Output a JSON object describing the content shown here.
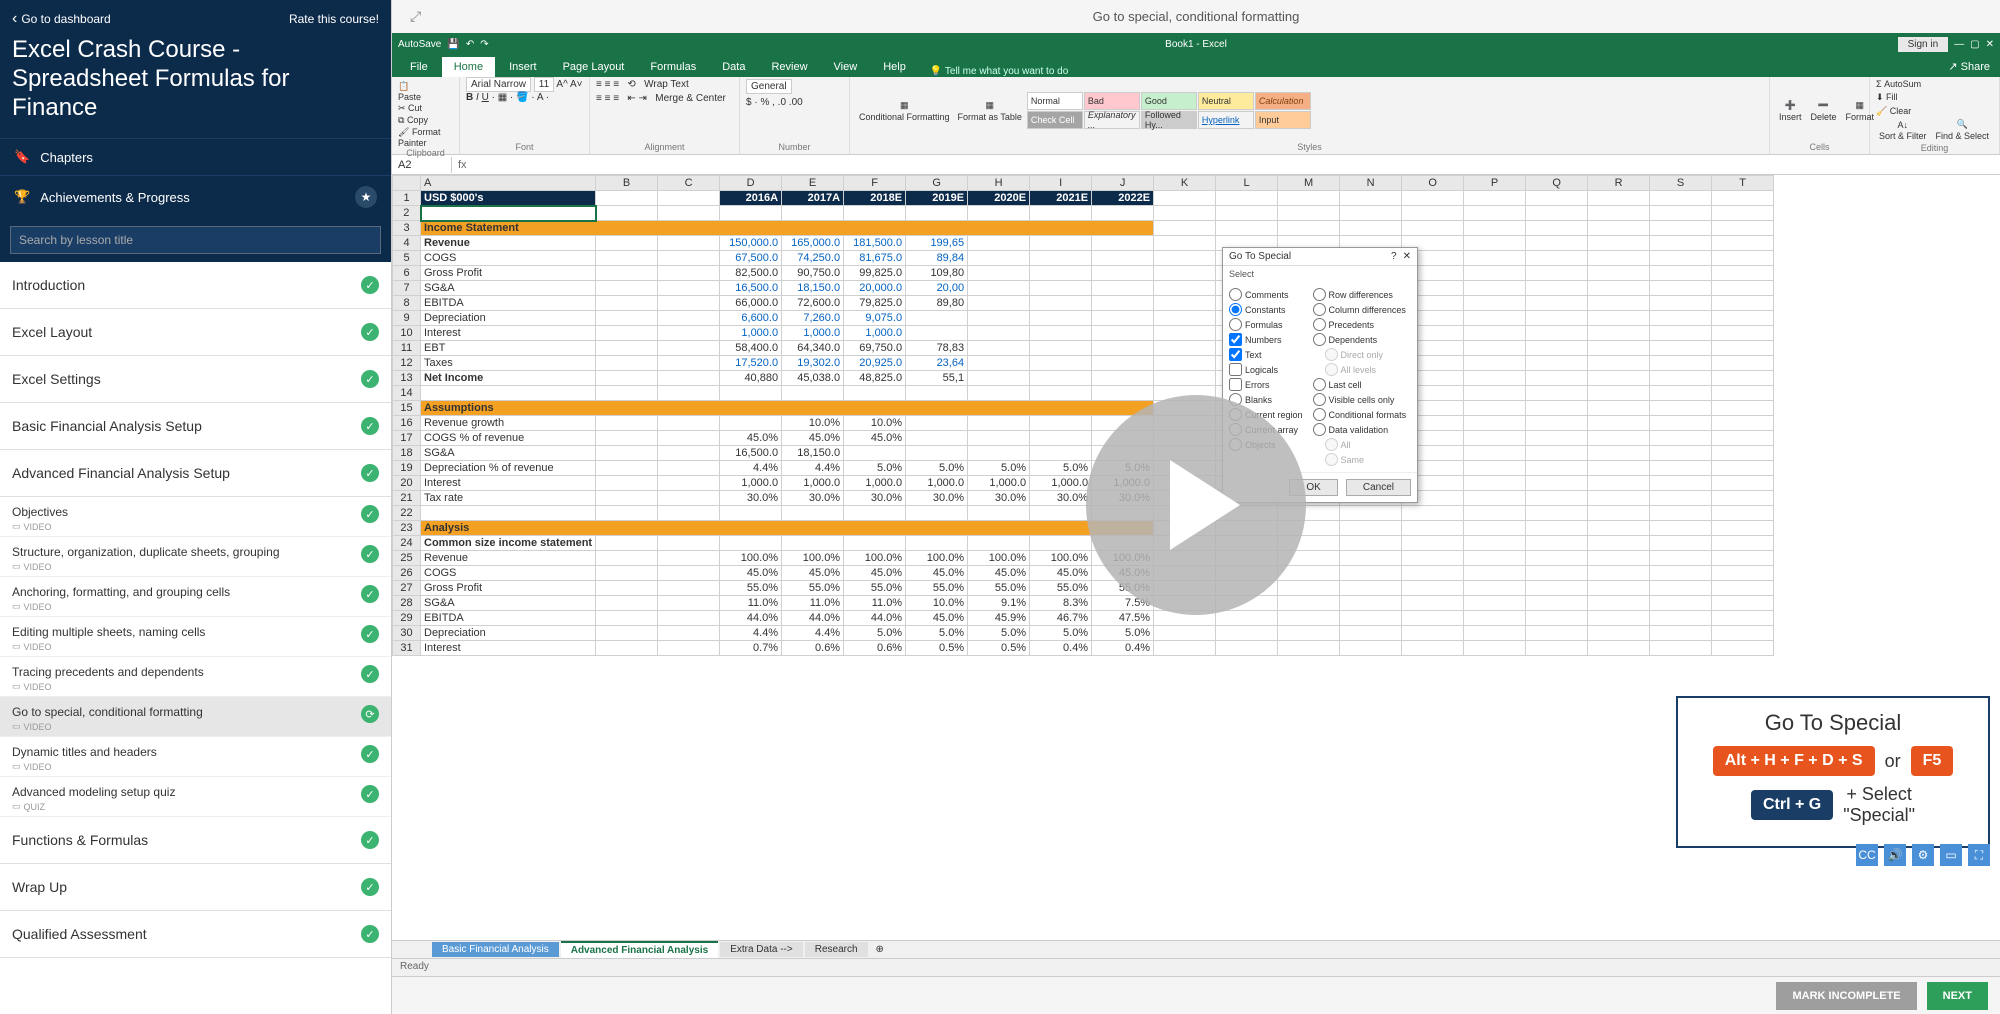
{
  "sidebar": {
    "back": "Go to dashboard",
    "rate": "Rate this course!",
    "course_title": "Excel Crash Course - Spreadsheet Formulas for Finance",
    "chapters_label": "Chapters",
    "achievements_label": "Achievements & Progress",
    "search_placeholder": "Search by lesson title",
    "chapters": [
      {
        "label": "Introduction",
        "done": true
      },
      {
        "label": "Excel Layout",
        "done": true
      },
      {
        "label": "Excel Settings",
        "done": true
      },
      {
        "label": "Basic Financial Analysis Setup",
        "done": true
      },
      {
        "label": "Advanced Financial Analysis Setup",
        "done": true,
        "expanded": true,
        "lessons": [
          {
            "label": "Objectives",
            "type": "VIDEO",
            "done": true
          },
          {
            "label": "Structure, organization, duplicate sheets, grouping",
            "type": "VIDEO",
            "done": true
          },
          {
            "label": "Anchoring, formatting, and grouping cells",
            "type": "VIDEO",
            "done": true
          },
          {
            "label": "Editing multiple sheets, naming cells",
            "type": "VIDEO",
            "done": true
          },
          {
            "label": "Tracing precedents and dependents",
            "type": "VIDEO",
            "done": true
          },
          {
            "label": "Go to special, conditional formatting",
            "type": "VIDEO",
            "done": true,
            "active": true
          },
          {
            "label": "Dynamic titles and headers",
            "type": "VIDEO",
            "done": true
          },
          {
            "label": "Advanced modeling setup quiz",
            "type": "QUIZ",
            "done": true
          }
        ]
      },
      {
        "label": "Functions & Formulas",
        "done": true
      },
      {
        "label": "Wrap Up",
        "done": true
      },
      {
        "label": "Qualified Assessment",
        "done": true
      }
    ]
  },
  "main": {
    "lesson_title": "Go to special, conditional formatting",
    "footer": {
      "incomplete": "MARK INCOMPLETE",
      "next": "NEXT"
    }
  },
  "excel": {
    "autosave": "AutoSave",
    "book": "Book1 - Excel",
    "signin": "Sign in",
    "share": "Share",
    "tabs": [
      "File",
      "Home",
      "Insert",
      "Page Layout",
      "Formulas",
      "Data",
      "Review",
      "View",
      "Help"
    ],
    "tell": "Tell me what you want to do",
    "ribbon": {
      "clipboard": {
        "label": "Clipboard",
        "cut": "Cut",
        "copy": "Copy",
        "painter": "Format Painter",
        "paste": "Paste"
      },
      "font": {
        "label": "Font",
        "name": "Arial Narrow",
        "size": "11"
      },
      "alignment": {
        "label": "Alignment",
        "wrap": "Wrap Text",
        "merge": "Merge & Center"
      },
      "number": {
        "label": "Number",
        "fmt": "General"
      },
      "styles": {
        "label": "Styles",
        "cond": "Conditional Formatting",
        "table": "Format as Table",
        "list": [
          "Normal",
          "Bad",
          "Good",
          "Neutral",
          "Calculation",
          "Check Cell",
          "Explanatory ...",
          "Followed Hy...",
          "Hyperlink",
          "Input"
        ]
      },
      "cells": {
        "label": "Cells",
        "insert": "Insert",
        "delete": "Delete",
        "format": "Format"
      },
      "editing": {
        "label": "Editing",
        "sum": "AutoSum",
        "fill": "Fill",
        "clear": "Clear",
        "sort": "Sort & Filter",
        "find": "Find & Select"
      }
    },
    "namebox": "A2",
    "cols": [
      "A",
      "B",
      "C",
      "D",
      "E",
      "F",
      "G",
      "H",
      "I",
      "J",
      "K",
      "L",
      "M",
      "N",
      "O",
      "P",
      "Q",
      "R",
      "S",
      "T"
    ],
    "years": [
      "2016A",
      "2017A",
      "2018E",
      "2019E",
      "2020E",
      "2021E",
      "2022E"
    ],
    "usd": "USD $000's",
    "rows": [
      {
        "n": 3,
        "a": "Income Statement",
        "cls": "shead"
      },
      {
        "n": 4,
        "a": "Revenue",
        "cls": "bold",
        "v": [
          "150,000.0",
          "165,000.0",
          "181,500.0",
          "199,65",
          "",
          "",
          ""
        ],
        "blue": true
      },
      {
        "n": 5,
        "a": "COGS",
        "v": [
          "67,500.0",
          "74,250.0",
          "81,675.0",
          "89,84",
          "",
          "",
          ""
        ],
        "blue": true
      },
      {
        "n": 6,
        "a": "Gross Profit",
        "v": [
          "82,500.0",
          "90,750.0",
          "99,825.0",
          "109,80",
          "",
          "",
          ""
        ]
      },
      {
        "n": 7,
        "a": "SG&A",
        "v": [
          "16,500.0",
          "18,150.0",
          "20,000.0",
          "20,00",
          "",
          "",
          ""
        ],
        "blue": true
      },
      {
        "n": 8,
        "a": "EBITDA",
        "v": [
          "66,000.0",
          "72,600.0",
          "79,825.0",
          "89,80",
          "",
          "",
          ""
        ]
      },
      {
        "n": 9,
        "a": "Depreciation",
        "v": [
          "6,600.0",
          "7,260.0",
          "9,075.0",
          "",
          "",
          "",
          ""
        ],
        "blue": true
      },
      {
        "n": 10,
        "a": "Interest",
        "v": [
          "1,000.0",
          "1,000.0",
          "1,000.0",
          "",
          "",
          "",
          ""
        ],
        "blue": true
      },
      {
        "n": 11,
        "a": "EBT",
        "v": [
          "58,400.0",
          "64,340.0",
          "69,750.0",
          "78,83",
          "",
          "",
          ""
        ]
      },
      {
        "n": 12,
        "a": "Taxes",
        "v": [
          "17,520.0",
          "19,302.0",
          "20,925.0",
          "23,64",
          "",
          "",
          ""
        ],
        "blue": true
      },
      {
        "n": 13,
        "a": "Net Income",
        "cls": "bold",
        "v": [
          "40,880",
          "45,038.0",
          "48,825.0",
          "55,1",
          "",
          "",
          ""
        ]
      },
      {
        "n": 14,
        "a": ""
      },
      {
        "n": 15,
        "a": "Assumptions",
        "cls": "shead"
      },
      {
        "n": 16,
        "a": "Revenue growth",
        "v": [
          "",
          "10.0%",
          "10.0%",
          "",
          "",
          "",
          ""
        ]
      },
      {
        "n": 17,
        "a": "COGS % of revenue",
        "v": [
          "45.0%",
          "45.0%",
          "45.0%",
          "",
          "",
          "",
          ""
        ]
      },
      {
        "n": 18,
        "a": "SG&A",
        "v": [
          "16,500.0",
          "18,150.0",
          "",
          "",
          "",
          "",
          ""
        ]
      },
      {
        "n": 19,
        "a": "Depreciation % of revenue",
        "v": [
          "4.4%",
          "4.4%",
          "5.0%",
          "5.0%",
          "5.0%",
          "5.0%",
          "5.0%"
        ]
      },
      {
        "n": 20,
        "a": "Interest",
        "v": [
          "1,000.0",
          "1,000.0",
          "1,000.0",
          "1,000.0",
          "1,000.0",
          "1,000.0",
          "1,000.0"
        ]
      },
      {
        "n": 21,
        "a": "Tax rate",
        "v": [
          "30.0%",
          "30.0%",
          "30.0%",
          "30.0%",
          "30.0%",
          "30.0%",
          "30.0%"
        ]
      },
      {
        "n": 22,
        "a": ""
      },
      {
        "n": 23,
        "a": "Analysis",
        "cls": "shead"
      },
      {
        "n": 24,
        "a": "Common size income statement",
        "cls": "bold"
      },
      {
        "n": 25,
        "a": "Revenue",
        "v": [
          "100.0%",
          "100.0%",
          "100.0%",
          "100.0%",
          "100.0%",
          "100.0%",
          "100.0%"
        ]
      },
      {
        "n": 26,
        "a": "COGS",
        "v": [
          "45.0%",
          "45.0%",
          "45.0%",
          "45.0%",
          "45.0%",
          "45.0%",
          "45.0%"
        ]
      },
      {
        "n": 27,
        "a": "Gross Profit",
        "v": [
          "55.0%",
          "55.0%",
          "55.0%",
          "55.0%",
          "55.0%",
          "55.0%",
          "55.0%"
        ]
      },
      {
        "n": 28,
        "a": "SG&A",
        "v": [
          "11.0%",
          "11.0%",
          "11.0%",
          "10.0%",
          "9.1%",
          "8.3%",
          "7.5%"
        ]
      },
      {
        "n": 29,
        "a": "EBITDA",
        "v": [
          "44.0%",
          "44.0%",
          "44.0%",
          "45.0%",
          "45.9%",
          "46.7%",
          "47.5%"
        ]
      },
      {
        "n": 30,
        "a": "Depreciation",
        "v": [
          "4.4%",
          "4.4%",
          "5.0%",
          "5.0%",
          "5.0%",
          "5.0%",
          "5.0%"
        ]
      },
      {
        "n": 31,
        "a": "Interest",
        "v": [
          "0.7%",
          "0.6%",
          "0.6%",
          "0.5%",
          "0.5%",
          "0.4%",
          "0.4%"
        ]
      }
    ],
    "sheet_tabs": [
      "Basic Financial Analysis",
      "Advanced Financial Analysis",
      "Extra Data -->",
      "Research"
    ],
    "status": "Ready"
  },
  "dialog": {
    "title": "Go To Special",
    "select": "Select",
    "left": [
      "Comments",
      "Constants",
      "Formulas",
      "Numbers",
      "Text",
      "Logicals",
      "Errors",
      "Blanks",
      "Current region",
      "Current array",
      "Objects"
    ],
    "right": [
      "Row differences",
      "Column differences",
      "Precedents",
      "Dependents",
      "Direct only",
      "All levels",
      "Last cell",
      "Visible cells only",
      "Conditional formats",
      "Data validation",
      "All",
      "Same"
    ],
    "ok": "OK",
    "cancel": "Cancel"
  },
  "shortcut": {
    "title": "Go To Special",
    "k1": "Alt + H + F + D + S",
    "or": "or",
    "k2": "F5",
    "k3": "Ctrl + G",
    "t1": "+ Select",
    "t2": "\"Special\""
  }
}
